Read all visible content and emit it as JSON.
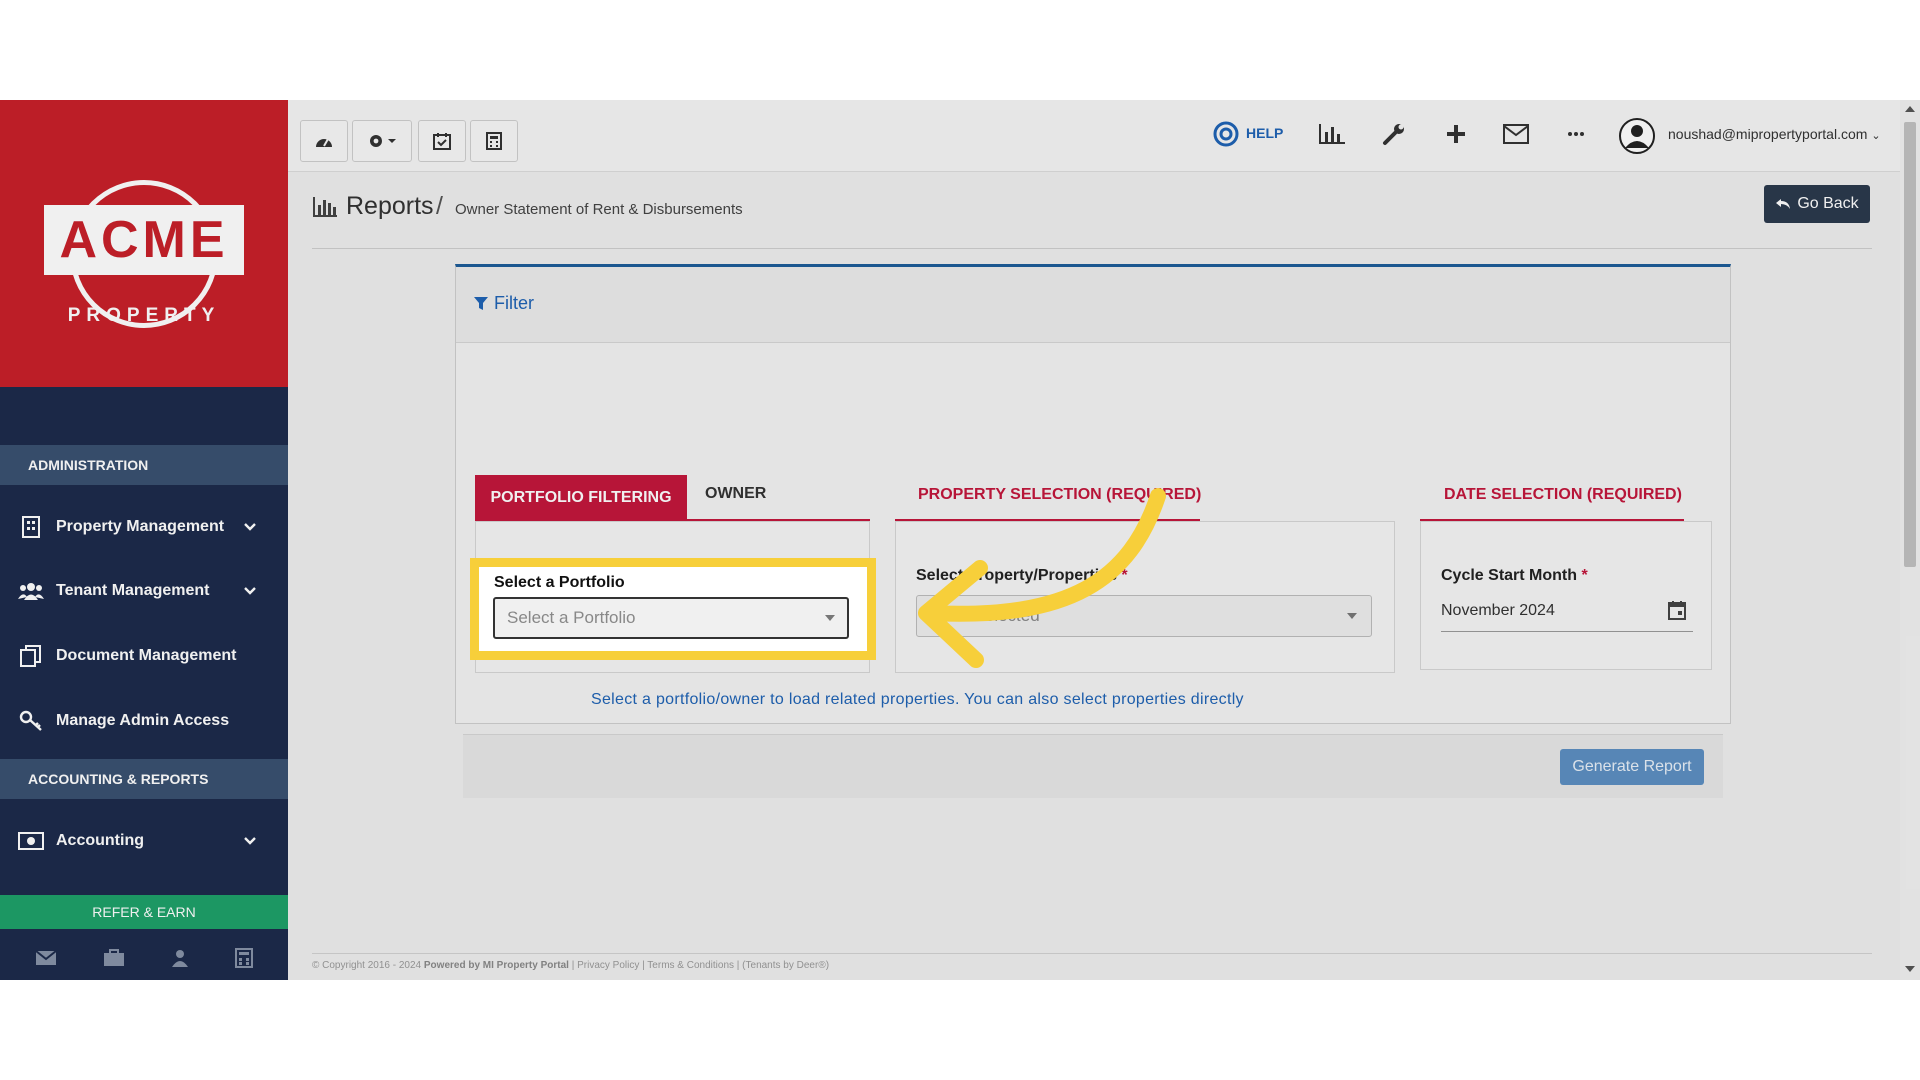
{
  "sidebar": {
    "logo_text": "ACME",
    "logo_sub": "PROPERTY",
    "section_admin": "ADMINISTRATION",
    "items": [
      {
        "label": "Property Management",
        "icon": "building-icon",
        "expandable": true
      },
      {
        "label": "Tenant Management",
        "icon": "users-icon",
        "expandable": true
      },
      {
        "label": "Document Management",
        "icon": "documents-icon",
        "expandable": false
      },
      {
        "label": "Manage Admin Access",
        "icon": "key-icon",
        "expandable": false
      }
    ],
    "section_accounting": "ACCOUNTING & REPORTS",
    "accounting_item": {
      "label": "Accounting",
      "icon": "money-icon",
      "expandable": true
    },
    "refer_label": "REFER & EARN",
    "footer_icons": [
      "mail-icon",
      "briefcase-icon",
      "user-icon",
      "calculator-icon"
    ]
  },
  "topbar": {
    "left_buttons": [
      "dashboard-icon",
      "settings-dropdown-icon",
      "calendar-check-icon",
      "calculator-icon"
    ],
    "help_label": "HELP",
    "right_icons": [
      "reports-chart-icon",
      "wrench-icon",
      "plus-icon",
      "mail-icon",
      "more-icon"
    ],
    "user_email": "noushad@mipropertyportal.com"
  },
  "page": {
    "title": "Reports",
    "separator": "/",
    "subtitle": "Owner Statement of Rent & Disbursements",
    "go_back_label": "Go Back"
  },
  "filter": {
    "title": "Filter",
    "tabs": {
      "portfolio": "PORTFOLIO FILTERING",
      "owner": "OWNER",
      "property": "PROPERTY SELECTION (REQUIRED)",
      "date": "DATE SELECTION (REQUIRED)"
    },
    "portfolio_label": "Select a Portfolio",
    "portfolio_placeholder": "Select a Portfolio",
    "property_label": "Select Property/Properties",
    "property_required_mark": "*",
    "property_placeholder": "None selected",
    "date_label": "Cycle Start Month",
    "date_required_mark": "*",
    "date_value": "November 2024",
    "hint": "Select a portfolio/owner to load related properties. You can also select properties directly",
    "generate_label": "Generate Report"
  },
  "footer": {
    "copyright": "© Copyright 2016 - 2024",
    "powered": "Powered by MI Property Portal",
    "links": "| Privacy Policy | Terms & Conditions |",
    "extra": "(Tenants by Deer®)"
  },
  "colors": {
    "brand_red": "#c8202a",
    "sidebar_navy": "#1d2b4c",
    "accent_crimson": "#c3173c",
    "link_blue": "#1f63b5",
    "highlight_yellow": "#f7cf3a"
  }
}
